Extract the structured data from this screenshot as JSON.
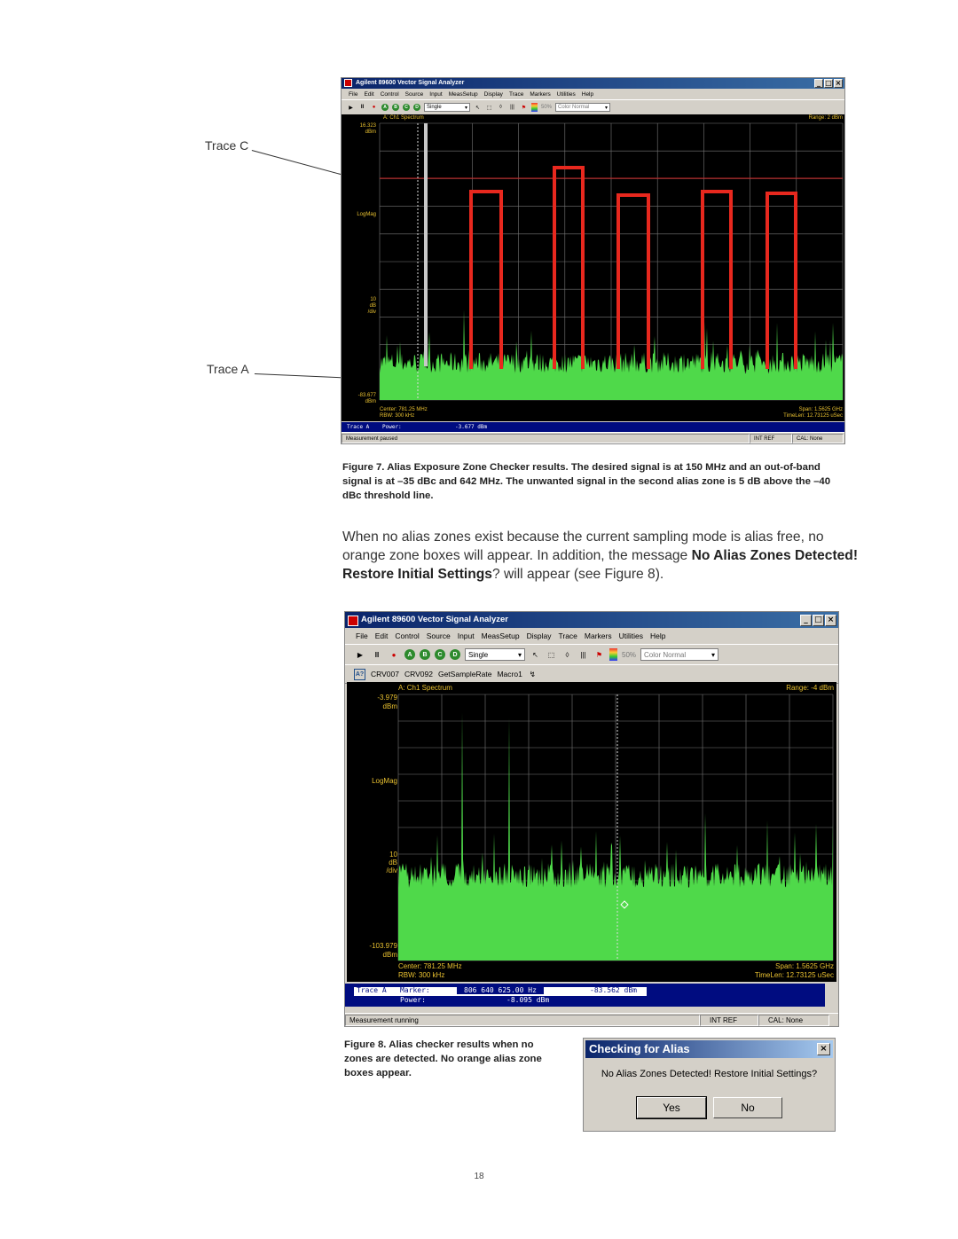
{
  "figure7": {
    "callout_trace_c": "Trace C",
    "callout_trace_a": "Trace A",
    "window": {
      "title": "Agilent 89600 Vector Signal Analyzer",
      "menu": [
        "File",
        "Edit",
        "Control",
        "Source",
        "Input",
        "MeasSetup",
        "Display",
        "Trace",
        "Markers",
        "Utilities",
        "Help"
      ],
      "trace_buttons": [
        "A",
        "B",
        "C",
        "D"
      ],
      "mode_select": "Single",
      "percent": "50%",
      "color_select": "Color Normal",
      "plot": {
        "title": "A: Ch1 Spectrum",
        "range": "Range: 2 dBm",
        "top_value": "16.323",
        "top_unit": "dBm",
        "scale_type": "LogMag",
        "div_value": "10",
        "div_unit": "dB",
        "div_label": "/div",
        "bottom_value": "-83.677",
        "bottom_unit": "dBm",
        "center": "Center: 781.25 MHz",
        "rbw": "RBW: 300 kHz",
        "span": "Span: 1.5625 GHz",
        "timelen": "TimeLen: 12.73125 uSec"
      },
      "marker_line": {
        "label": "Trace A",
        "field": "Power:",
        "value": "-3.677 dBm"
      },
      "status": {
        "text": "Measurement paused",
        "ref": "INT REF",
        "cal": "CAL: None"
      }
    },
    "caption": "Figure 7.  Alias Exposure Zone Checker results. The desired signal is at 150 MHz and an out-of-band signal is at –35 dBc and 642 MHz. The unwanted signal in the second alias zone is 5 dB above the –40 dBc threshold line.",
    "colors": {
      "trace": "#4fd94a",
      "alias_box": "#e8281e",
      "threshold": "#c81e1e"
    }
  },
  "paragraph": {
    "part1": "When no alias zones exist because the current sampling mode is alias free, no orange zone boxes will appear. In addition, the message ",
    "bold1": "No Alias Zones Detected! Restore Initial Settings",
    "part2": "? will appear (see Figure 8)."
  },
  "figure8": {
    "window": {
      "title": "Agilent 89600 Vector Signal Analyzer",
      "menu": [
        "File",
        "Edit",
        "Control",
        "Source",
        "Input",
        "MeasSetup",
        "Display",
        "Trace",
        "Markers",
        "Utilities",
        "Help"
      ],
      "trace_buttons": [
        "A",
        "B",
        "C",
        "D"
      ],
      "mode_select": "Single",
      "percent": "50%",
      "color_select": "Color Normal",
      "macro_bar": [
        "CRV007",
        "CRV092",
        "GetSampleRate",
        "Macro1"
      ],
      "plot": {
        "title": "A: Ch1 Spectrum",
        "range": "Range: -4 dBm",
        "top_value": "-3.979",
        "top_unit": "dBm",
        "scale_type": "LogMag",
        "div_value": "10",
        "div_unit": "dB",
        "div_label": "/div",
        "bottom_value": "-103.979",
        "bottom_unit": "dBm",
        "center": "Center: 781.25 MHz",
        "rbw": "RBW: 300 kHz",
        "span": "Span: 1.5625 GHz",
        "timelen": "TimeLen: 12.73125 uSec"
      },
      "marker_line1": {
        "label": "Trace A",
        "field": "Marker:",
        "freq": "806 640 625.00 Hz",
        "value": "-83.562 dBm"
      },
      "marker_line2": {
        "field": "Power:",
        "value": "-8.095 dBm"
      },
      "status": {
        "text": "Measurement running",
        "ref": "INT REF",
        "cal": "CAL: None"
      }
    },
    "caption": "Figure 8. Alias checker results when no zones are detected. No orange alias zone boxes appear.",
    "dialog": {
      "title": "Checking for Alias",
      "message": "No Alias Zones Detected! Restore Initial Settings?",
      "yes": "Yes",
      "no": "No"
    }
  },
  "page_number": "18"
}
